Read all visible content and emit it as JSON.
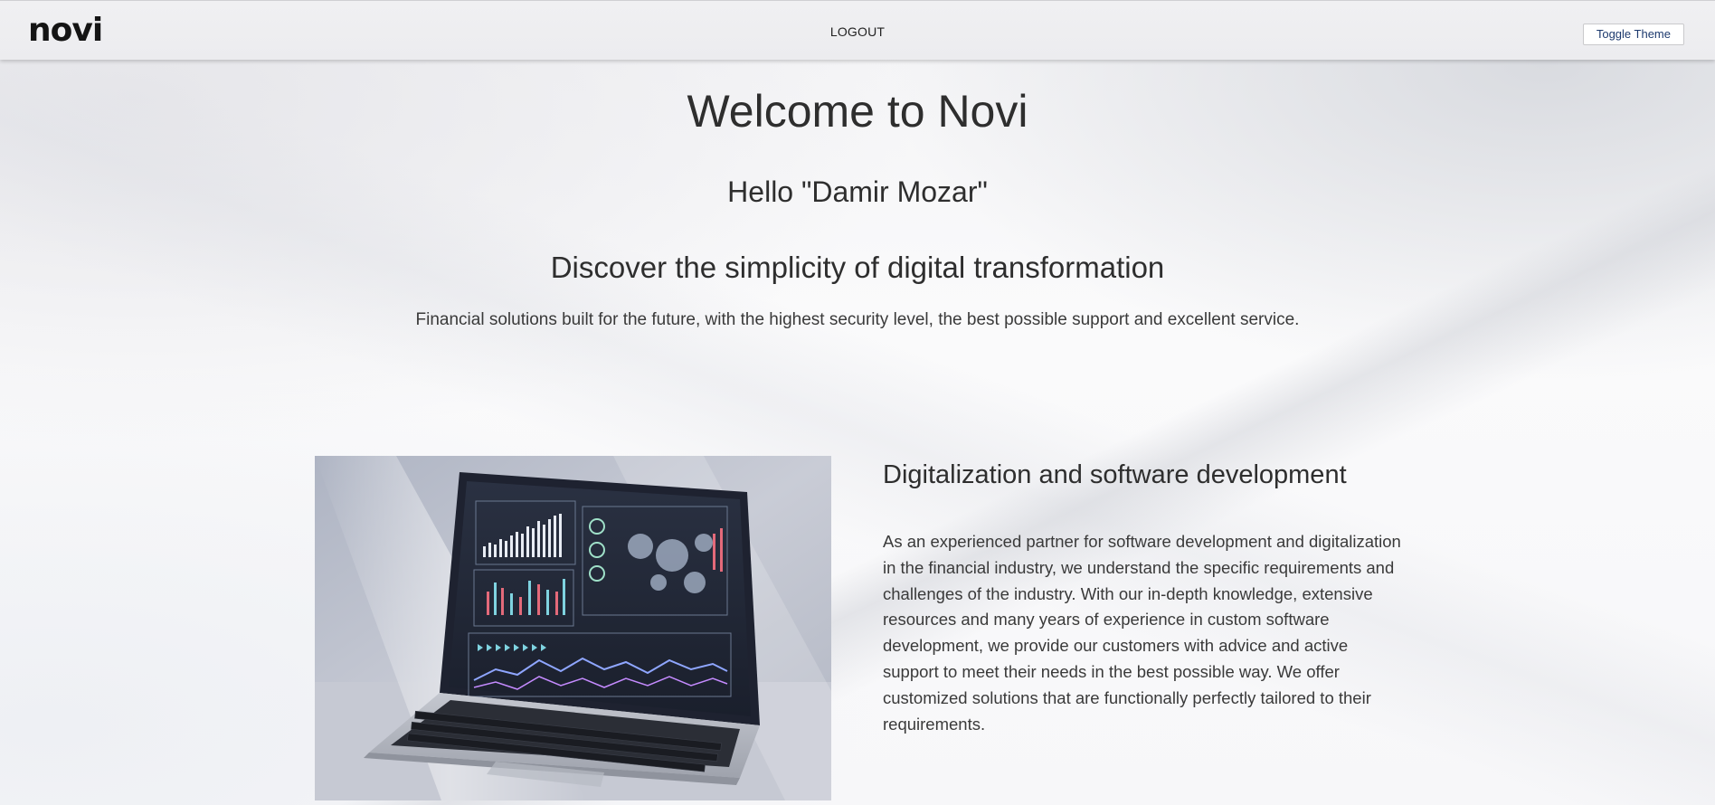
{
  "header": {
    "logo": "novi",
    "nav_logout": "LOGOUT",
    "toggle_theme": "Toggle Theme"
  },
  "hero": {
    "welcome": "Welcome to Novi",
    "hello": "Hello \"Damir Mozar\"",
    "headline": "Discover the simplicity of digital transformation",
    "tagline": "Financial solutions built for the future, with the highest security level, the best possible support and excellent service."
  },
  "feature": {
    "title": "Digitalization and software development",
    "body": "As an experienced partner for software development and digitalization in the financial industry, we understand the specific requirements and challenges of the industry. With our in-depth knowledge, extensive resources and many years of experience in custom software development, we provide our customers with advice and active support to meet their needs in the best possible way. We offer customized solutions that are functionally perfectly tailored to their requirements."
  },
  "colors": {
    "button_text": "#1d3a6e",
    "text_primary": "#2e2e2e"
  }
}
